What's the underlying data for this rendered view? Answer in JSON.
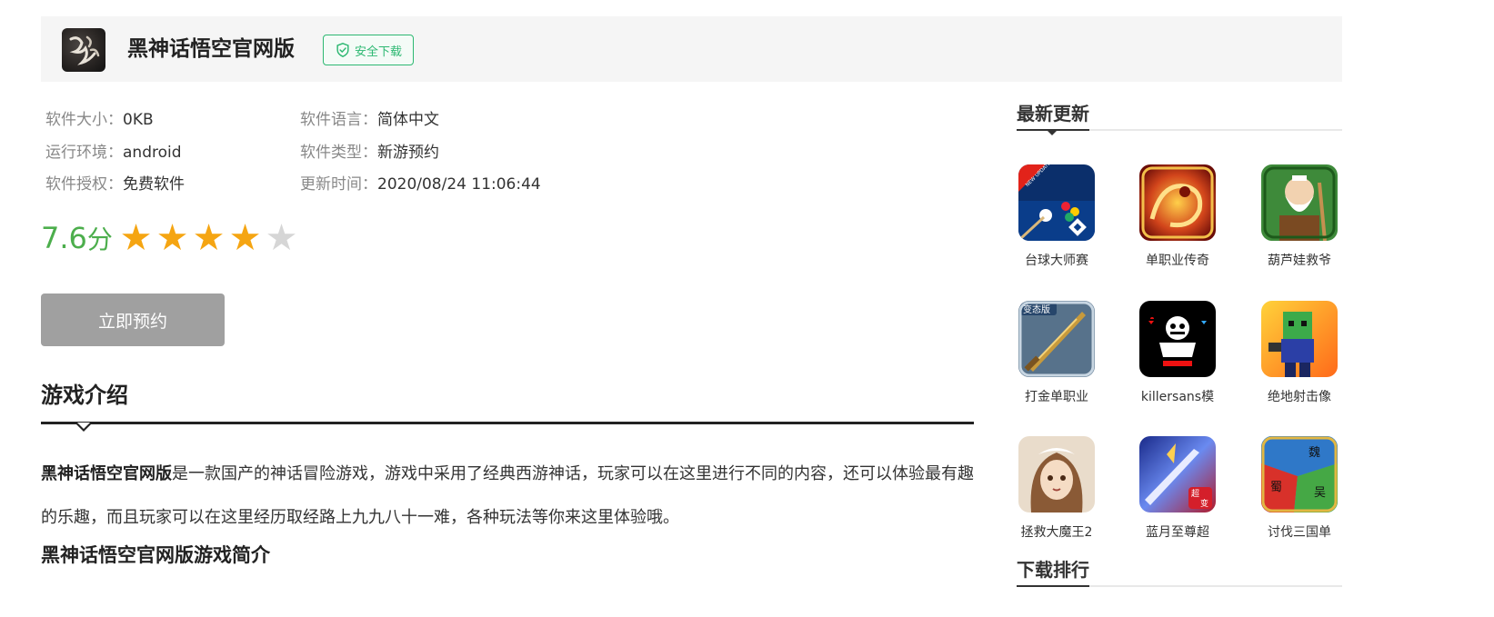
{
  "header": {
    "title": "黑神话悟空官网版",
    "safe_badge": "安全下载",
    "icon_glyph": "悟空"
  },
  "info": {
    "size": {
      "label": "软件大小：",
      "value": "0KB"
    },
    "language": {
      "label": "软件语言：",
      "value": "简体中文"
    },
    "env": {
      "label": "运行环境：",
      "value": "android"
    },
    "type": {
      "label": "软件类型：",
      "value": "新游预约"
    },
    "license": {
      "label": "软件授权：",
      "value": "免费软件"
    },
    "updated": {
      "label": "更新时间：",
      "value": "2020/08/24 11:06:44"
    }
  },
  "rating": {
    "score": "7.6",
    "unit": "分",
    "stars_filled": 4,
    "stars_total": 5,
    "star_glyph": "★"
  },
  "reserve_button": "立即预约",
  "intro": {
    "section_title": "游戏介绍",
    "bold_lead": "黑神话悟空官网版",
    "text": "是一款国产的神话冒险游戏，游戏中采用了经典西游神话，玩家可以在这里进行不同的内容，还可以体验最有趣的乐趣，而且玩家可以在这里经历取经路上九九八十一难，各种玩法等你来这里体验哦。",
    "sub_title": "黑神话悟空官网版游戏简介"
  },
  "sidebar": {
    "latest_title": "最新更新",
    "ranking_title": "下载排行",
    "apps": [
      {
        "name": "台球大师赛",
        "icon": "billiards-icon",
        "badge": "NEW UPDATE"
      },
      {
        "name": "单职业传奇",
        "icon": "dragon-icon"
      },
      {
        "name": "葫芦娃救爷",
        "icon": "grandpa-icon"
      },
      {
        "name": "打金单职业",
        "icon": "sword-icon",
        "badge": "变态版"
      },
      {
        "name": "killersans模",
        "icon": "skeleton-icon"
      },
      {
        "name": "绝地射击像",
        "icon": "blocky-soldier-icon"
      },
      {
        "name": "拯救大魔王2",
        "icon": "maid-girl-icon"
      },
      {
        "name": "蓝月至尊超",
        "icon": "warrior-icon",
        "badge": "超变"
      },
      {
        "name": "讨伐三国单",
        "icon": "three-kingdoms-map-icon",
        "badge_words": [
          "魏",
          "蜀",
          "吴"
        ]
      }
    ]
  },
  "colors": {
    "accent_green": "#2db872",
    "score_green": "#4cae4c",
    "star_gold": "#f5a512",
    "button_gray": "#a0a0a0"
  }
}
